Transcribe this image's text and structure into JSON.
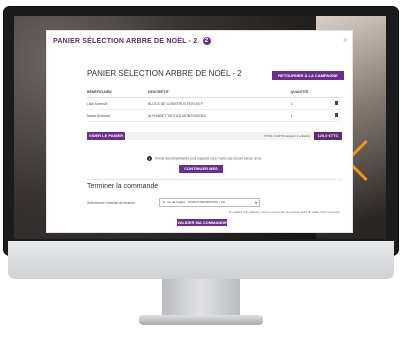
{
  "modal": {
    "title": "PANIER SÉLECTION ARBRE DE NOËL - 2",
    "badge_count": "2",
    "close": "×"
  },
  "panel": {
    "title": "PANIER SÉLECTION ARBRE DE NOËL - 2",
    "return_button": "RETOURNER À LA CAMPAGNE"
  },
  "cart": {
    "columns": [
      "BÉNÉFICIAIRE",
      "DESCRIPTIF",
      "QUANTITÉ"
    ],
    "rows": [
      {
        "beneficiary": "Lisa Schmutt",
        "description": "BLOCS DE CONSTRUCTION 50 P",
        "quantity": "1"
      },
      {
        "beneficiary": "Maria Schmutt",
        "description": "ALPHABET TACTILE MONTESSORI",
        "quantity": "1"
      }
    ],
    "empty_button": "VIDER LE PANIER",
    "total_label": "TOTAL 0 ARTICLE(pour 2 enfants)",
    "total_amount": "120,0 €TTC"
  },
  "info": {
    "icon": "info-icon",
    "text": "Il reste des bénéficiaires pour lesquels vous n'avez pas encore fait de choix.",
    "continue_button": "CONTINUER MES CHOIX"
  },
  "checkout": {
    "title": "Terminer la commande",
    "address_label": "Sélectionner l'adresse de livraison",
    "address_value": "N, rue de l'église - 67000 STRASBOURG - FR",
    "consent_text": "En validant votre sélection, vous ne pourrez plus de retourner avant de valider votre commande.",
    "validate_button": "VALIDER MA COMMANDE"
  },
  "colors": {
    "accent": "#6b2e8c",
    "accent_dark": "#5b2c6f",
    "orange": "#f3921d"
  }
}
